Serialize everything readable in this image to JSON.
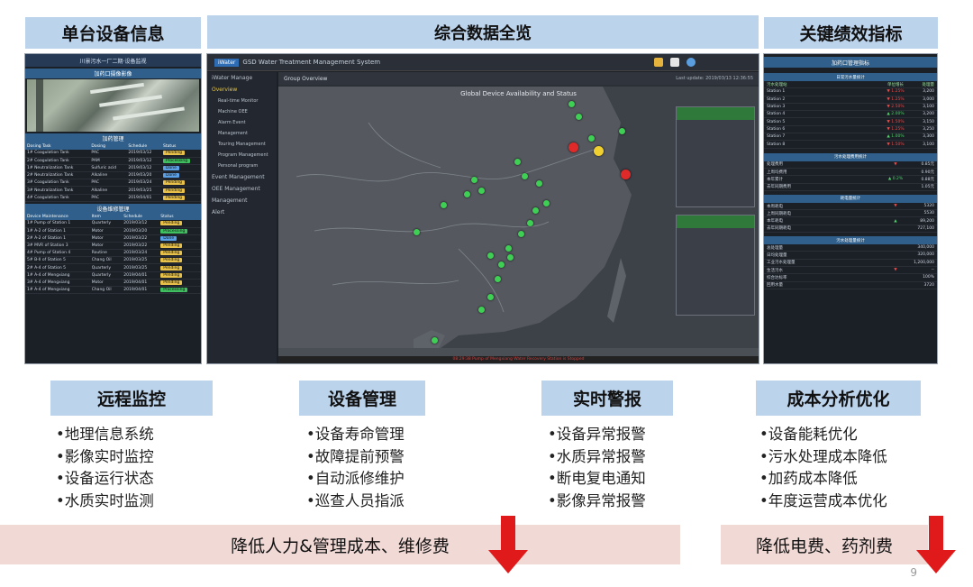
{
  "headers": {
    "device": "单台设备信息",
    "overview": "综合数据全览",
    "kpi": "关键绩效指标"
  },
  "device_panel": {
    "title": "川景污水一厂二期·设备监视",
    "video_label": "加药口摄像影像",
    "task_title": "加药管理",
    "task_columns": [
      "Dosing Task",
      "Dosing",
      "Schedule",
      "Status"
    ],
    "tasks": [
      {
        "name": "1# Coagulation Tank",
        "dosing": "PAC",
        "date": "2019/03/12",
        "status": "Pending",
        "kind": "pending"
      },
      {
        "name": "2# Coagulation Tank",
        "dosing": "PAM",
        "date": "2019/03/12",
        "status": "Processing",
        "kind": "progress"
      },
      {
        "name": "1# Neutralization Tank",
        "dosing": "Sulfuric acid",
        "date": "2019/03/12",
        "status": "Done",
        "kind": "done"
      },
      {
        "name": "2# Neutralization Tank",
        "dosing": "Alkaline",
        "date": "2019/03/20",
        "status": "Done",
        "kind": "done"
      },
      {
        "name": "3# Coagulation Tank",
        "dosing": "PAC",
        "date": "2019/03/24",
        "status": "Pending",
        "kind": "pending"
      },
      {
        "name": "3# Neutralization Tank",
        "dosing": "Alkaline",
        "date": "2019/03/25",
        "status": "Pending",
        "kind": "pending"
      },
      {
        "name": "4# Coagulation Tank",
        "dosing": "PAC",
        "date": "2019/04/01",
        "status": "Pending",
        "kind": "pending"
      }
    ],
    "maint_title": "设备维修管理",
    "maint_columns": [
      "Device Maintenance",
      "Item",
      "Schedule",
      "Status"
    ],
    "maint": [
      {
        "name": "1# Pump of Station 1",
        "item": "Quarterly",
        "date": "2019/03/12",
        "status": "Pending",
        "kind": "pending"
      },
      {
        "name": "1# A-2 of Station 1",
        "item": "Motor",
        "date": "2019/03/20",
        "status": "Processing",
        "kind": "progress"
      },
      {
        "name": "2# A-2 of Station 1",
        "item": "Motor",
        "date": "2019/03/22",
        "status": "Done",
        "kind": "done"
      },
      {
        "name": "3# MVR of Station 3",
        "item": "Motor",
        "date": "2019/03/22",
        "status": "Pending",
        "kind": "pending"
      },
      {
        "name": "4# Pump of Station 4",
        "item": "Routine",
        "date": "2019/03/24",
        "status": "Pending",
        "kind": "pending"
      },
      {
        "name": "5# B-II of Station 5",
        "item": "Chang Oil",
        "date": "2019/03/25",
        "status": "Pending",
        "kind": "pending"
      },
      {
        "name": "2# A-4 of Station 5",
        "item": "Quarterly",
        "date": "2019/03/25",
        "status": "Pending",
        "kind": "pending"
      },
      {
        "name": "1# A-4 of Mengxiang",
        "item": "Quarterly",
        "date": "2019/04/01",
        "status": "Pending",
        "kind": "pending"
      },
      {
        "name": "3# A-4 of Mengxiang",
        "item": "Motor",
        "date": "2019/04/01",
        "status": "Pending",
        "kind": "pending"
      },
      {
        "name": "1# A-4 of Mengxiang",
        "item": "Chang Oil",
        "date": "2019/04/01",
        "status": "Processing",
        "kind": "progress"
      }
    ]
  },
  "overview_panel": {
    "logo": "iWater",
    "system_title": "GSD Water Treatment Management System",
    "sidebar": [
      "iWater Manage",
      "Overview",
      "Real-time Monitor",
      "Machine OEE",
      "Alarm Event",
      "Management",
      "Touring Management",
      "Program Management",
      "Personal program",
      "Event Management",
      "OEE Management",
      "Management",
      "Alert"
    ],
    "group_label": "Group Overview",
    "last_update": "Last update: 2019/03/13 12:36:55",
    "map_title": "Global Device Availability and Status",
    "footer_alert": "08:29:38 Pump of Mengxiang Water Recovery Station is Stopped"
  },
  "kpi_panel": {
    "title": "加药口管理指标",
    "sec1": "日常污水量统计",
    "sec1_cols": [
      "污水处理站",
      "单位增长",
      "处理量"
    ],
    "stations": [
      {
        "name": "Station 1",
        "delta": "▼ 1.25%",
        "value": "3,200",
        "dir": "dn"
      },
      {
        "name": "Station 2",
        "delta": "▼ 1.25%",
        "value": "3,000",
        "dir": "dn"
      },
      {
        "name": "Station 3",
        "delta": "▼ 2.50%",
        "value": "3,100",
        "dir": "dn"
      },
      {
        "name": "Station 4",
        "delta": "▲ 2.00%",
        "value": "3,200",
        "dir": "up"
      },
      {
        "name": "Station 5",
        "delta": "▼ 1.50%",
        "value": "3,150",
        "dir": "dn"
      },
      {
        "name": "Station 6",
        "delta": "▼ 1.25%",
        "value": "3,250",
        "dir": "dn"
      },
      {
        "name": "Station 7",
        "delta": "▲ 1.00%",
        "value": "3,300",
        "dir": "up"
      },
      {
        "name": "Station 8",
        "delta": "▼ 1.50%",
        "value": "3,100",
        "dir": "dn"
      }
    ],
    "sec2": "污水处理费用统计",
    "sec2_rows": [
      {
        "name": "处理费用",
        "delta": "▼",
        "value": "0.85元"
      },
      {
        "name": "上周均费用",
        "delta": "",
        "value": "0.90元"
      },
      {
        "name": "本年累计",
        "delta": "▲ 0.2%",
        "value": "0.88元"
      },
      {
        "name": "去年同期费用",
        "delta": "",
        "value": "1.05元"
      }
    ],
    "sec3": "耗电量统计",
    "sec3_rows": [
      {
        "name": "本周耗电",
        "delta": "▼",
        "value": "5320"
      },
      {
        "name": "上周同期耗电",
        "delta": "",
        "value": "5530"
      },
      {
        "name": "本年耗电",
        "delta": "▲",
        "value": "89,200"
      },
      {
        "name": "去年同期耗电",
        "delta": "",
        "value": "727,100"
      }
    ],
    "sec4": "污水处理量统计",
    "sec4_rows": [
      {
        "name": "总处理量",
        "delta": "",
        "value": "340,000"
      },
      {
        "name": "日均处理量",
        "delta": "",
        "value": "320,000"
      },
      {
        "name": "工业污水处理量",
        "delta": "",
        "value": "1,200,000"
      },
      {
        "name": "生活污水",
        "delta": "▼",
        "value": "--"
      },
      {
        "name": "综合达标率",
        "delta": "",
        "value": "100%"
      },
      {
        "name": "回用水量",
        "delta": "",
        "value": "3720"
      }
    ]
  },
  "features": [
    {
      "title": "远程监控",
      "items": [
        "•地理信息系统",
        "•影像实时监控",
        "•设备运行状态",
        "•水质实时监测"
      ]
    },
    {
      "title": "设备管理",
      "items": [
        "•设备寿命管理",
        "•故障提前预警",
        "•自动派修维护",
        "•巡查人员指派"
      ]
    },
    {
      "title": "实时警报",
      "items": [
        "•设备异常报警",
        "•水质异常报警",
        "•断电复电通知",
        "•影像异常报警"
      ]
    },
    {
      "title": "成本分析优化",
      "items": [
        "•设备能耗优化",
        "•污水处理成本降低",
        "•加药成本降低",
        "•年度运营成本优化"
      ]
    }
  ],
  "bands": {
    "left": "降低人力&管理成本、维修费",
    "right": "降低电费、药剂费"
  },
  "page_number": "9",
  "colors": {
    "header_bg": "#bcd3ec",
    "band_bg": "#f1d9d6",
    "arrow": "#e01a1a"
  }
}
